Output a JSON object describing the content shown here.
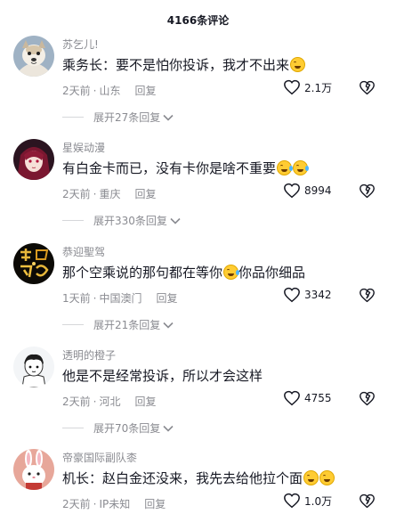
{
  "header": {
    "title": "4166条评论"
  },
  "comments": [
    {
      "username": "苏乞儿!",
      "text": "乘务长：要不是怕你投诉，我才不出来",
      "emojis": 1,
      "time": "2天前",
      "location": "山东",
      "reply": "回复",
      "likes": "2.1万",
      "expand": "展开27条回复",
      "avatar_icon": "dog-avatar-icon"
    },
    {
      "username": "星娱动漫",
      "text": "有白金卡而已，没有卡你是啥不重要",
      "emojis": 2,
      "time": "2天前",
      "location": "重庆",
      "reply": "回复",
      "likes": "8994",
      "expand": "展开330条回复",
      "avatar_icon": "anime-girl-avatar-icon"
    },
    {
      "username": "恭迎聖驾",
      "text": "那个空乘说的那句都在等你",
      "text_after": "你品你细品",
      "emojis": 1,
      "time": "1天前",
      "location": "中国澳门",
      "reply": "回复",
      "likes": "3342",
      "expand": "展开21条回复",
      "avatar_icon": "gold-calligraphy-avatar-icon"
    },
    {
      "username": "透明的橙子",
      "text": "他是不是经常投诉，所以才会这样",
      "emojis": 0,
      "time": "2天前",
      "location": "河北",
      "reply": "回复",
      "likes": "4755",
      "expand": "展开70条回复",
      "avatar_icon": "cartoon-boy-avatar-icon"
    },
    {
      "username": "帝豪国际副队桼",
      "text": "机长：赵白金还没来，我先去给他拉个面",
      "emojis": 2,
      "time": "2天前",
      "location": "IP未知",
      "reply": "回复",
      "likes": "1.0万",
      "expand": "",
      "avatar_icon": "rabbit-avatar-icon"
    }
  ],
  "colors": {
    "text": "#161823",
    "secondary": "#8a8b91",
    "emoji": "#ffcc33"
  }
}
